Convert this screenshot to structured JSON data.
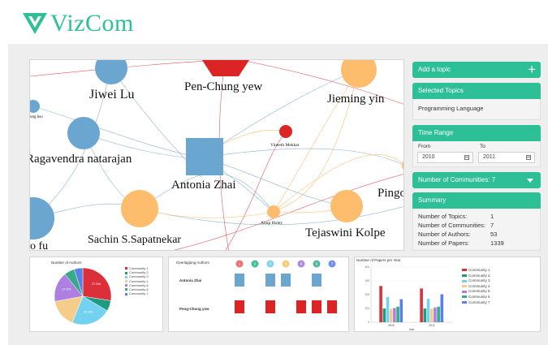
{
  "app": {
    "name": "VizCom"
  },
  "colors": {
    "brand": "#2dbf95",
    "blue": "#6aa6cf",
    "orange": "#fdbd6d",
    "red": "#dd2424",
    "panel_bg": "#f4f4f4",
    "workspace_bg": "#eeeeee"
  },
  "graph": {
    "nodes": [
      {
        "label": "Jiwei Lu",
        "kind": "circle",
        "color": "blue"
      },
      {
        "label": "Pen-Chung yew",
        "kind": "trapezoid",
        "color": "red"
      },
      {
        "label": "Jieming yin",
        "kind": "circle",
        "color": "orange"
      },
      {
        "label": "ung hsu",
        "kind": "circle",
        "color": "blue"
      },
      {
        "label": "Vineeth Mekkat",
        "kind": "circle",
        "color": "red"
      },
      {
        "label": "Ragavendra natarajan",
        "kind": "circle",
        "color": "blue"
      },
      {
        "label": "Antonia Zhai",
        "kind": "square",
        "color": "blue"
      },
      {
        "label": "Pingo",
        "kind": "circle",
        "color": "orange"
      },
      {
        "label": "Anup Holey",
        "kind": "circle",
        "color": "orange"
      },
      {
        "label": "Tejaswini Kolpe",
        "kind": "circle",
        "color": "orange"
      },
      {
        "label": "Sachin S.Sapatnekar",
        "kind": "circle",
        "color": "orange"
      },
      {
        "label": "o fu",
        "kind": "circle",
        "color": "blue"
      }
    ]
  },
  "sidebar": {
    "add_topic": {
      "label": "Add a topic",
      "icon": "plus-icon"
    },
    "selected_topics": {
      "title": "Selected Topics",
      "items": [
        "Programming Language"
      ]
    },
    "time_range": {
      "title": "Time Range",
      "from_label": "From",
      "from_value": "2010",
      "to_label": "To",
      "to_value": "2011",
      "icon": "calendar-icon"
    },
    "communities_dropdown": {
      "label": "Number of Communities: 7",
      "icon": "chevron-down-icon"
    },
    "summary": {
      "title": "Summary",
      "rows": [
        {
          "label": "Number of Topics:",
          "value": "1"
        },
        {
          "label": "Number of Communities:",
          "value": "7"
        },
        {
          "label": "Number of Authors:",
          "value": "53"
        },
        {
          "label": "Number of Papers:",
          "value": "1339"
        }
      ]
    }
  },
  "pie_card": {
    "title": "Number of Authors",
    "legend": [
      "Community 1",
      "Community 2",
      "Community 3",
      "Community 4",
      "Community 5",
      "Community 6",
      "Community 7"
    ],
    "colors": [
      "#dd2f39",
      "#1e9b82",
      "#73d2f0",
      "#f6cc8a",
      "#ad7fe0",
      "#37aa8a",
      "#5a80e8"
    ],
    "slice_labels": [
      "27.5%",
      "",
      "22.6%",
      "",
      "17.0%",
      "",
      ""
    ]
  },
  "overlap_card": {
    "title": "Overlapping Authors",
    "communities": [
      "1",
      "2",
      "3",
      "4",
      "5",
      "6",
      "7"
    ],
    "community_colors": [
      "#f07070",
      "#3fbf9a",
      "#7fd4ef",
      "#f6cc7a",
      "#b08ae2",
      "#4fb8a0",
      "#7090ea"
    ],
    "rows": [
      {
        "author": "Antonia Zhai",
        "color": "#6aa6cf",
        "present": [
          true,
          false,
          true,
          true,
          false,
          true,
          false
        ]
      },
      {
        "author": "Peng-Chung yew",
        "color": "#dd2424",
        "present": [
          true,
          false,
          true,
          false,
          true,
          true,
          true
        ]
      }
    ]
  },
  "chart_data": {
    "type": "bar",
    "title": "Number of Papers per Year",
    "xlabel": "Year",
    "ylabel": "",
    "categories": [
      "2010",
      "2011"
    ],
    "ylim": [
      0,
      400
    ],
    "yticks": [
      "0",
      "100",
      "200",
      "300",
      "400"
    ],
    "series": [
      {
        "name": "Community 1",
        "color": "#dd2f39",
        "values": [
          263,
          245
        ]
      },
      {
        "name": "Community 2",
        "color": "#1e9b82",
        "values": [
          100,
          100
        ]
      },
      {
        "name": "Community 3",
        "color": "#73d2f0",
        "values": [
          183,
          170
        ]
      },
      {
        "name": "Community 4",
        "color": "#f6cc8a",
        "values": [
          97,
          97
        ]
      },
      {
        "name": "Community 5",
        "color": "#ad7fe0",
        "values": [
          103,
          107
        ]
      },
      {
        "name": "Community 6",
        "color": "#37aa8a",
        "values": [
          113,
          113
        ]
      },
      {
        "name": "Community 7",
        "color": "#5a80e8",
        "values": [
          167,
          203
        ]
      }
    ]
  }
}
